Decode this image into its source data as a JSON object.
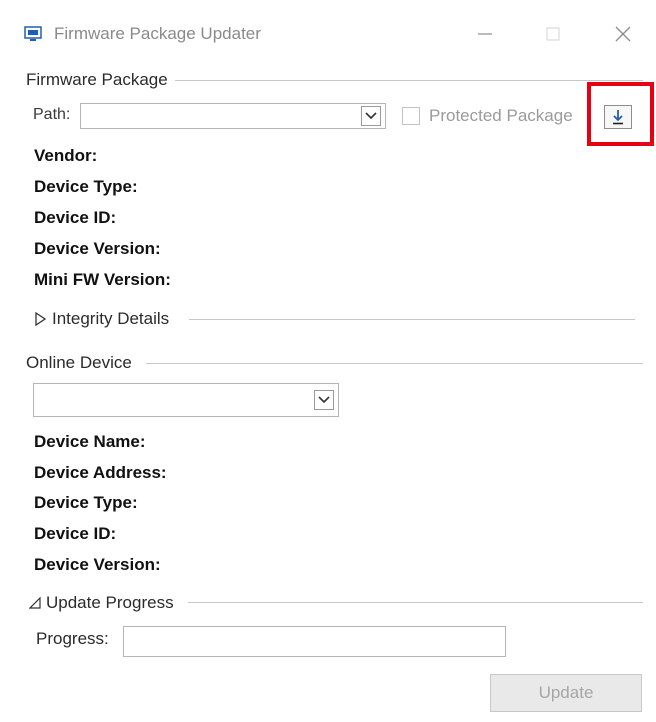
{
  "window": {
    "title": "Firmware Package Updater",
    "icons": [
      "app-icon",
      "minimize-icon",
      "maximize-icon",
      "close-icon"
    ]
  },
  "firmware_package": {
    "header": "Firmware Package",
    "path_label": "Path:",
    "path_value": "",
    "protected_label": "Protected Package",
    "protected_checked": false,
    "fields": [
      {
        "label": "Vendor:",
        "value": ""
      },
      {
        "label": "Device Type:",
        "value": ""
      },
      {
        "label": "Device ID:",
        "value": ""
      },
      {
        "label": "Device Version:",
        "value": ""
      },
      {
        "label": "Mini FW Version:",
        "value": ""
      }
    ],
    "integrity_header": "Integrity Details",
    "integrity_expanded": false
  },
  "online_device": {
    "header": "Online Device",
    "selected": "",
    "fields": [
      {
        "label": "Device Name:",
        "value": ""
      },
      {
        "label": "Device Address:",
        "value": ""
      },
      {
        "label": "Device Type:",
        "value": ""
      },
      {
        "label": "Device ID:",
        "value": ""
      },
      {
        "label": "Device Version:",
        "value": ""
      }
    ]
  },
  "update_progress": {
    "header": "Update Progress",
    "expanded": true,
    "progress_label": "Progress:",
    "progress_value": "",
    "update_label": "Update",
    "update_enabled": false
  },
  "colors": {
    "highlight": "#e60012",
    "disabled_text": "#a6a6a6",
    "accent_icon": "#1f5fb4"
  }
}
